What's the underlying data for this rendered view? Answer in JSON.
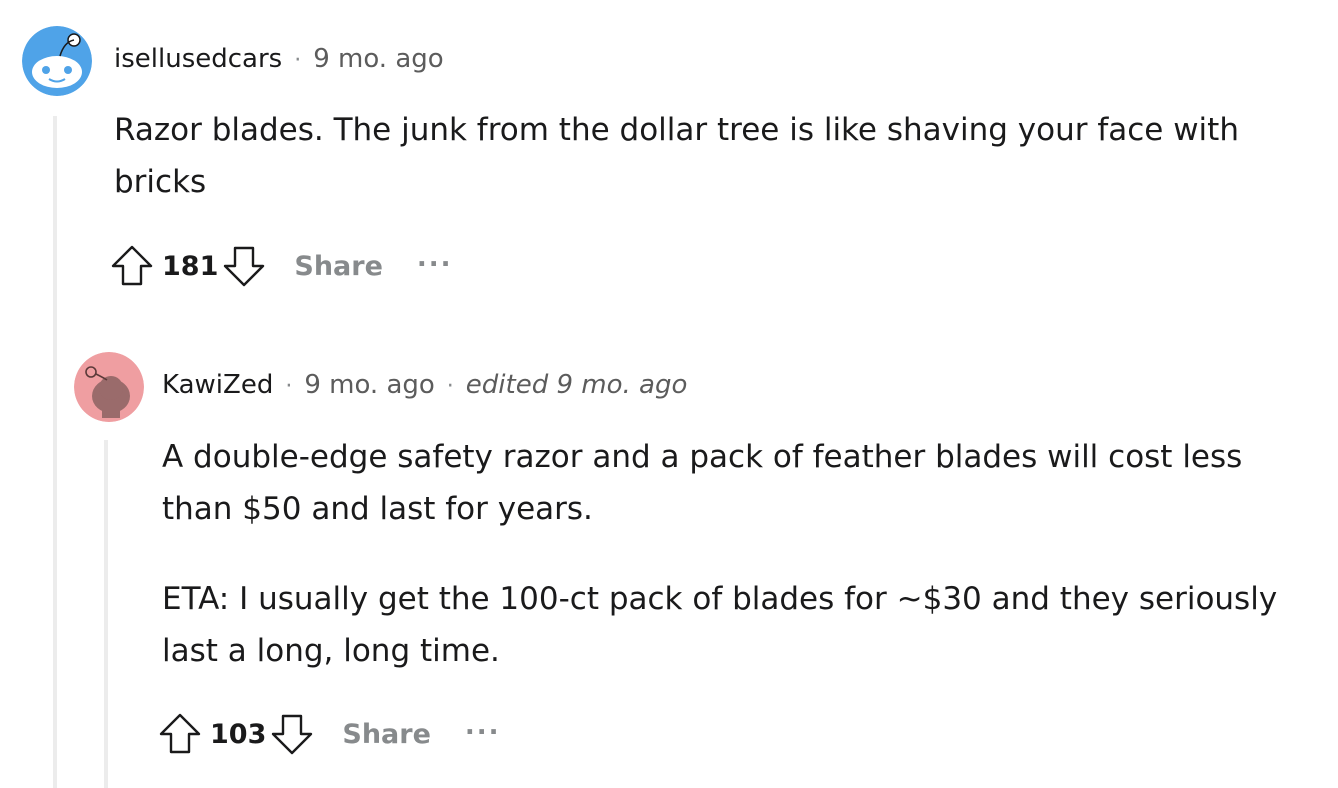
{
  "comments": [
    {
      "username": "isellusedcars",
      "time": "9 mo. ago",
      "paragraphs": [
        "Razor blades. The junk from the dollar tree is like shaving your face with bricks"
      ],
      "score": "181",
      "share_label": "Share",
      "more_label": "..."
    },
    {
      "username": "KawiZed",
      "time": "9 mo. ago",
      "edited": "edited 9 mo. ago",
      "paragraphs": [
        "A double-edge safety razor and a pack of feather blades will cost less than $50 and last for years.",
        "ETA: I usually get the 100-ct pack of blades for ~$30 and they seriously last a long, long time."
      ],
      "score": "103",
      "share_label": "Share",
      "more_label": "..."
    }
  ],
  "colors": {
    "avatar_blue": "#4fa3e8",
    "avatar_pink": "#ef9ea1",
    "muted": "#878a8c"
  },
  "icons": [
    "snoo-avatar-icon",
    "upvote-icon",
    "downvote-icon",
    "more-options-icon"
  ]
}
